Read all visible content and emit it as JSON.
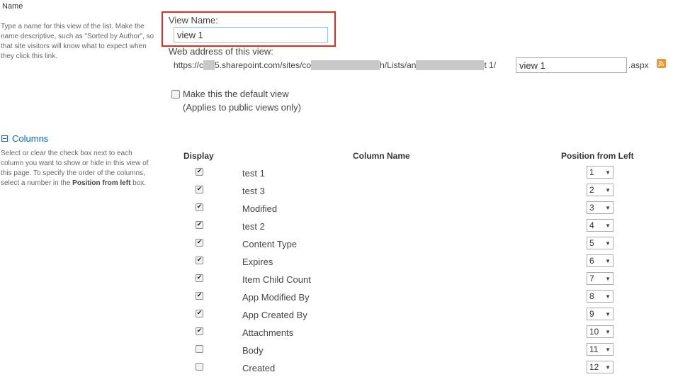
{
  "name_section": {
    "title": "Name",
    "description": "Type a name for this view of the list. Make the name descriptive, such as \"Sorted by Author\", so that site visitors will know what to expect when they click this link."
  },
  "view_name": {
    "label": "View Name:",
    "value": "view 1"
  },
  "web_address": {
    "label": "Web address of this view:",
    "prefix": "https://c",
    "mid1": "5.sharepoint.com/sites/co",
    "mid2": "h/Lists/an",
    "mid3": "t 1/",
    "input_value": "view 1",
    "suffix": ".aspx"
  },
  "default_view": {
    "label": "Make this the default view",
    "note": "(Applies to public views only)"
  },
  "columns_section": {
    "title": "Columns",
    "description_1": "Select or clear the check box next to each column you want to show or hide in this view of this page. To specify the order of the columns, select a number in the ",
    "description_bold": "Position from left",
    "description_2": " box."
  },
  "table": {
    "headers": {
      "display": "Display",
      "column_name": "Column Name",
      "position": "Position from Left"
    },
    "rows": [
      {
        "checked": true,
        "name": "test 1",
        "position": "1"
      },
      {
        "checked": true,
        "name": "test 3",
        "position": "2"
      },
      {
        "checked": true,
        "name": "Modified",
        "position": "3"
      },
      {
        "checked": true,
        "name": "test 2",
        "position": "4"
      },
      {
        "checked": true,
        "name": "Content Type",
        "position": "5"
      },
      {
        "checked": true,
        "name": "Expires",
        "position": "6"
      },
      {
        "checked": true,
        "name": "Item Child Count",
        "position": "7"
      },
      {
        "checked": true,
        "name": "App Modified By",
        "position": "8"
      },
      {
        "checked": true,
        "name": "App Created By",
        "position": "9"
      },
      {
        "checked": true,
        "name": "Attachments",
        "position": "10"
      },
      {
        "checked": false,
        "name": "Body",
        "position": "11"
      },
      {
        "checked": false,
        "name": "Created",
        "position": "12"
      }
    ]
  },
  "colors": {
    "accent": "#0072c6",
    "highlight": "#e02a2a",
    "rss": "#f7941d"
  }
}
